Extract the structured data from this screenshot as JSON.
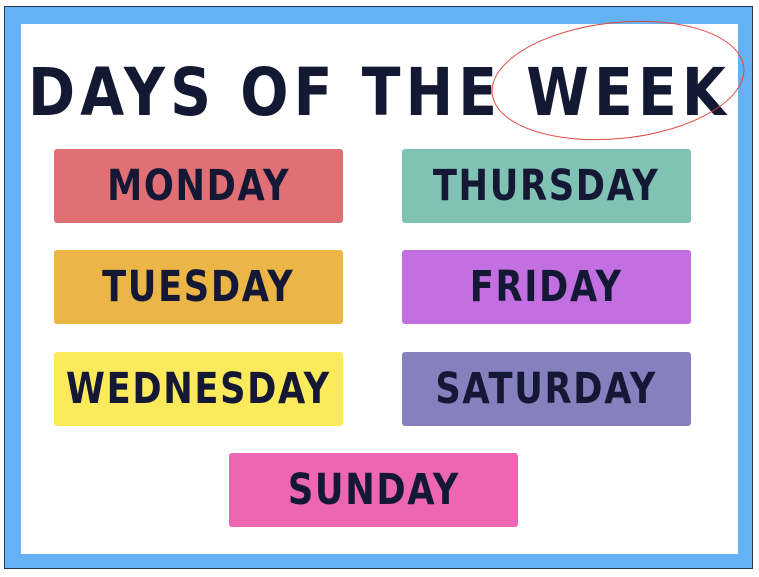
{
  "title": {
    "words": [
      "DAYS",
      "OF",
      "THE",
      "WEEK"
    ],
    "circled_word": "WEEK"
  },
  "days": [
    {
      "label": "MONDAY",
      "color": "#e16f76"
    },
    {
      "label": "TUESDAY",
      "color": "#ecb547"
    },
    {
      "label": "WEDNESDAY",
      "color": "#fbea5c"
    },
    {
      "label": "THURSDAY",
      "color": "#80c3b5"
    },
    {
      "label": "FRIDAY",
      "color": "#c26fe2"
    },
    {
      "label": "SATURDAY",
      "color": "#8780bf"
    },
    {
      "label": "SUNDAY",
      "color": "#ec66b2"
    }
  ],
  "colors": {
    "frame": "#64b1f4",
    "text": "#131833",
    "highlight_ring": "#e0473d"
  }
}
